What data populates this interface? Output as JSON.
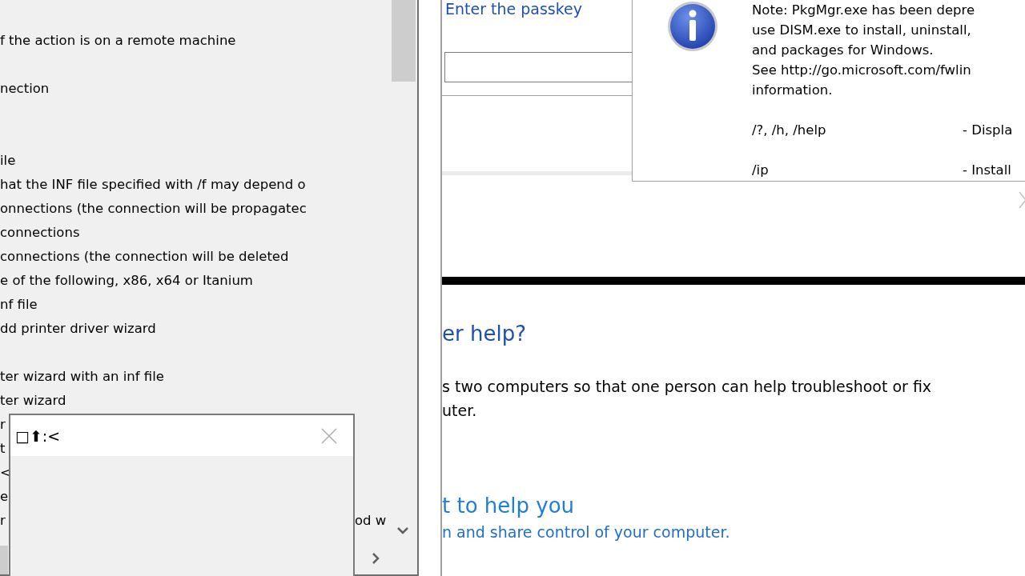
{
  "console_window": {
    "blocks": [
      [
        "f the action is on a remote machine"
      ],
      [
        "nection"
      ],
      [
        "ile",
        "hat the INF file specified with /f may depend o",
        "onnections (the connection will be propagatec",
        " connections",
        " connections (the connection will be deleted",
        "e of the following, x86, x64 or Itanium",
        "nf file",
        "dd printer driver wizard"
      ],
      [
        "ter wizard with an inf file",
        "ter wizard",
        "r",
        "t",
        "<",
        "e",
        "r"
      ]
    ],
    "fragment": "od w"
  },
  "small_dialog": {
    "title": "□⬆:<"
  },
  "passkey_window": {
    "heading": "Enter the passkey"
  },
  "info_dialog": {
    "note_lines": [
      "Note: PkgMgr.exe has been depre",
      "use DISM.exe to install, uninstall,",
      "and packages for Windows.",
      "See http://go.microsoft.com/fwlin",
      "information."
    ],
    "options": [
      {
        "flag": "/?, /h, /help",
        "description": "- Displa"
      },
      {
        "flag": "/ip",
        "description": "- Install"
      }
    ]
  },
  "help_window": {
    "heading": "er help?",
    "paragraph_lines": [
      "s two computers so that one person can help troubleshoot or fix",
      "uter."
    ],
    "link_title": "t to help you",
    "link_text": "n and share control of your computer."
  }
}
